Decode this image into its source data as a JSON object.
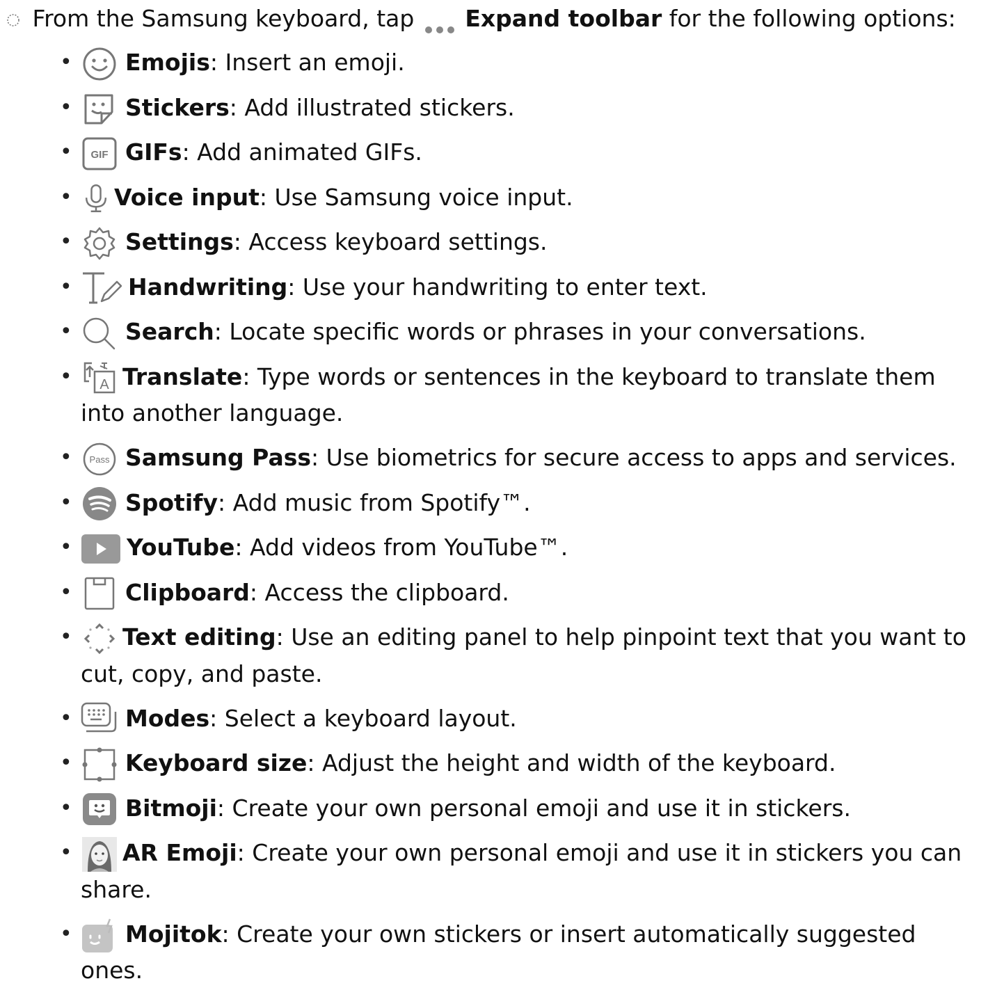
{
  "intro": {
    "prefix": "From the Samsung keyboard, tap",
    "action": "Expand toolbar",
    "suffix": "for the following options:"
  },
  "items": [
    {
      "icon": "emoji-icon",
      "label": "Emojis",
      "desc": "Insert an emoji."
    },
    {
      "icon": "sticker-icon",
      "label": "Stickers",
      "desc": "Add illustrated stickers."
    },
    {
      "icon": "gif-icon",
      "label": "GIFs",
      "desc": "Add animated GIFs."
    },
    {
      "icon": "microphone-icon",
      "label": "Voice input",
      "desc": "Use Samsung voice input."
    },
    {
      "icon": "gear-icon",
      "label": "Settings",
      "desc": "Access keyboard settings."
    },
    {
      "icon": "handwriting-icon",
      "label": "Handwriting",
      "desc": "Use your handwriting to enter text."
    },
    {
      "icon": "search-icon",
      "label": "Search",
      "desc": "Locate specific words or phrases in your conversations."
    },
    {
      "icon": "translate-icon",
      "label": "Translate",
      "desc": "Type words or sentences in the keyboard to translate them into another language."
    },
    {
      "icon": "samsung-pass-icon",
      "label": "Samsung Pass",
      "desc": "Use biometrics for secure access to apps and services."
    },
    {
      "icon": "spotify-icon",
      "label": "Spotify",
      "desc": "Add music from Spotify™."
    },
    {
      "icon": "youtube-icon",
      "label": "YouTube",
      "desc": "Add videos from YouTube™."
    },
    {
      "icon": "clipboard-icon",
      "label": "Clipboard",
      "desc": "Access the clipboard."
    },
    {
      "icon": "text-editing-icon",
      "label": "Text editing",
      "desc": "Use an editing panel to help pinpoint text that you want to cut, copy, and paste."
    },
    {
      "icon": "keyboard-modes-icon",
      "label": "Modes",
      "desc": "Select a keyboard layout."
    },
    {
      "icon": "keyboard-size-icon",
      "label": "Keyboard size",
      "desc": "Adjust the height and width of the keyboard."
    },
    {
      "icon": "bitmoji-icon",
      "label": "Bitmoji",
      "desc": "Create your own personal emoji and use it in stickers."
    },
    {
      "icon": "ar-emoji-icon",
      "label": "AR Emoji",
      "desc": "Create your own personal emoji and use it in stickers you can share."
    },
    {
      "icon": "mojitok-icon",
      "label": "Mojitok",
      "desc": "Create your own stickers or insert automatically suggested ones."
    }
  ]
}
